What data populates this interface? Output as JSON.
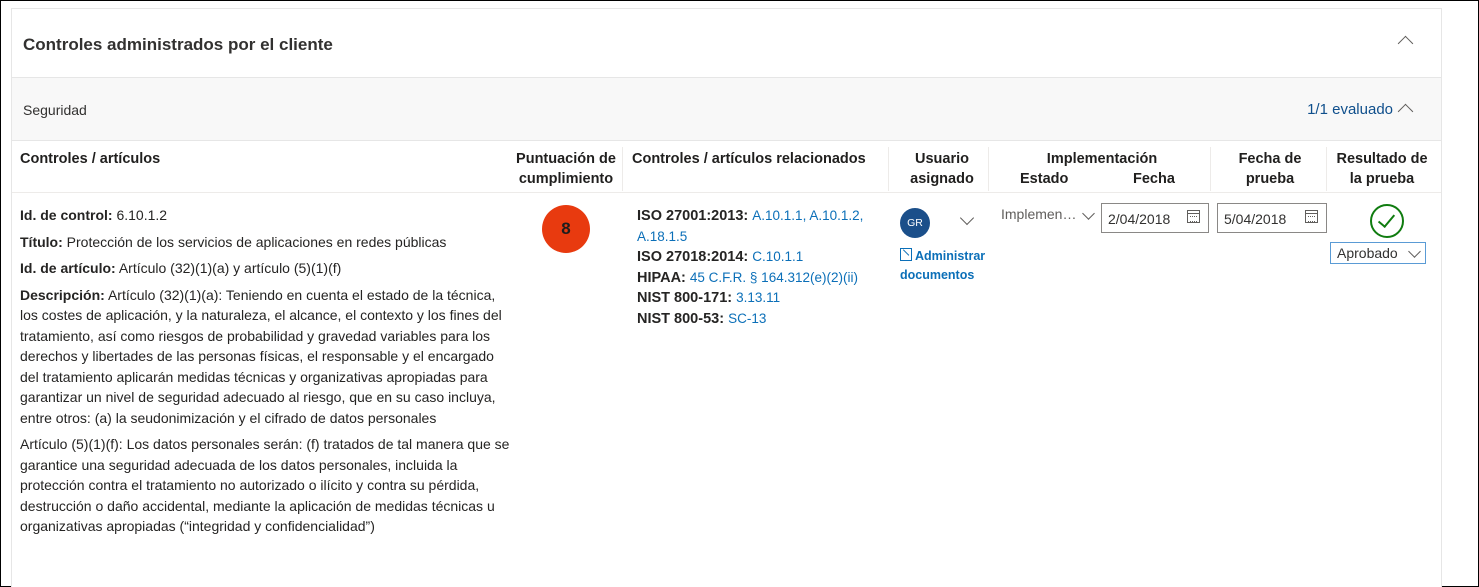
{
  "panel": {
    "title": "Controles administrados por el cliente"
  },
  "section": {
    "label": "Seguridad",
    "count": "1/1 evaluado"
  },
  "columns": {
    "controls": "Controles / artículos",
    "score_line1": "Puntuación de",
    "score_line2": "cumplimiento",
    "related": "Controles / artículos relacionados",
    "user_line1": "Usuario",
    "user_line2": "asignado",
    "implementation": "Implementación",
    "impl_state": "Estado",
    "impl_date": "Fecha",
    "test_date_line1": "Fecha de",
    "test_date_line2": "prueba",
    "test_result_line1": "Resultado de",
    "test_result_line2": "la prueba"
  },
  "control": {
    "id_label": "Id. de control:",
    "id_value": "6.10.1.2",
    "title_label": "Título:",
    "title_value": "Protección de los servicios de aplicaciones en redes públicas",
    "article_label": "Id. de artículo:",
    "article_value": "Artículo (32)(1)(a) y artículo (5)(1)(f)",
    "desc_label": "Descripción:",
    "desc_value": "Artículo (32)(1)(a): Teniendo en cuenta el estado de la técnica, los costes de aplicación, y la naturaleza, el alcance, el contexto y los fines del tratamiento, así como riesgos de probabilidad y gravedad variables para los derechos y libertades de las personas físicas, el responsable y el encargado del tratamiento aplicarán medidas técnicas y organizativas apropiadas para garantizar un nivel de seguridad adecuado al riesgo, que en su caso incluya, entre otros: (a) la seudonimización y el cifrado de datos personales",
    "desc_value2": "Artículo (5)(1)(f): Los datos personales serán: (f) tratados de tal manera que se garantice una seguridad adecuada de los datos personales, incluida la protección contra el tratamiento no autorizado o ilícito y contra su pérdida, destrucción o daño accidental, mediante la aplicación de medidas técnicas u organizativas apropiadas (“integridad y confidencialidad”)",
    "score": "8",
    "score_color": "#e83a0f"
  },
  "related": [
    {
      "standard": "ISO 27001:2013:",
      "refs": "A.10.1.1, A.10.1.2, A.18.1.5"
    },
    {
      "standard": "ISO 27018:2014:",
      "refs": "C.10.1.1"
    },
    {
      "standard": "HIPAA:",
      "refs": "45 C.F.R. § 164.312(e)(2)(ii)"
    },
    {
      "standard": "NIST 800-171:",
      "refs": "3.13.11"
    },
    {
      "standard": "NIST 800-53:",
      "refs": "SC-13"
    }
  ],
  "assignment": {
    "avatar_initials": "GR",
    "avatar_color": "#1b4f8a",
    "manage_docs": "Administrar documentos",
    "impl_state_value": "Implemen…",
    "impl_date_value": "2/04/2018",
    "test_date_value": "5/04/2018",
    "test_result_value": "Aprobado",
    "pass_color": "#107c10"
  },
  "icons": {
    "collapse": "chevron-up-icon",
    "dropdown": "chevron-down-icon",
    "calendar": "calendar-icon",
    "document": "document-icon",
    "pass": "check-circle-icon"
  }
}
